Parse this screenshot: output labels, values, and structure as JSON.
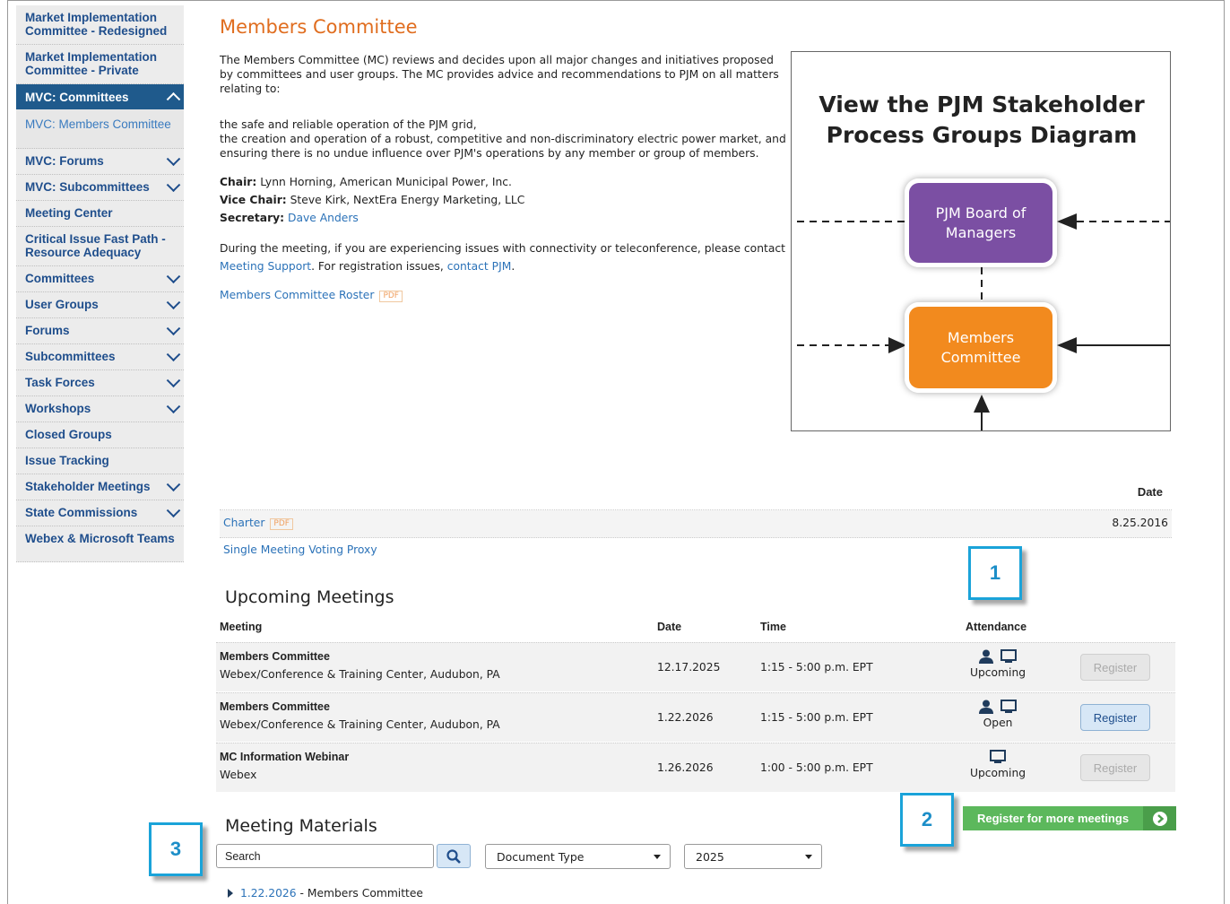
{
  "sidebar": {
    "items": [
      {
        "label": "Market Implementation Committee - Redesigned"
      },
      {
        "label": "Market Implementation Committee - Private"
      },
      {
        "label": "MVC: Committees"
      },
      {
        "label": "MVC: Members Committee"
      },
      {
        "label": "MVC: Forums"
      },
      {
        "label": "MVC: Subcommittees"
      },
      {
        "label": "Meeting Center"
      },
      {
        "label": "Critical Issue Fast Path - Resource Adequacy"
      },
      {
        "label": "Committees"
      },
      {
        "label": "User Groups"
      },
      {
        "label": "Forums"
      },
      {
        "label": "Subcommittees"
      },
      {
        "label": "Task Forces"
      },
      {
        "label": "Workshops"
      },
      {
        "label": "Closed Groups"
      },
      {
        "label": "Issue Tracking"
      },
      {
        "label": "Stakeholder Meetings"
      },
      {
        "label": "State Commissions"
      },
      {
        "label": "Webex & Microsoft Teams"
      }
    ]
  },
  "page": {
    "title": "Members Committee",
    "intro": "The Members Committee (MC) reviews and decides upon all major changes and initiatives proposed by committees and user groups. The MC provides advice and recommendations to PJM on all matters relating to:",
    "bullet1": "the safe and reliable operation of the PJM grid,",
    "bullet2": "the creation and operation of a robust, competitive and non-discriminatory electric power market, and",
    "bullet3": "ensuring there is no undue influence over PJM's operations by any member or group of members.",
    "chair_label": "Chair:",
    "chair_value": "Lynn Horning, American Municipal Power, Inc.",
    "vice_label": "Vice Chair:",
    "vice_value": "Steve Kirk, NextEra Energy Marketing, LLC",
    "secretary_label": "Secretary:",
    "secretary_value": "Dave Anders",
    "support_text1": "During the meeting, if you are experiencing issues with connectivity or teleconference, please contact",
    "support_link": "Meeting Support",
    "support_text2": ". For registration issues,",
    "contact_link": "contact PJM",
    "support_text3": ".",
    "roster_link": "Members Committee Roster",
    "pdf_badge": "PDF"
  },
  "diagram": {
    "title_line1": "View the PJM Stakeholder",
    "title_line2": "Process Groups Diagram",
    "box1": "PJM Board of Managers",
    "box2": "Members Committee",
    "box1_color": "#7b4fa3",
    "box2_color": "#f28a1e"
  },
  "documents": {
    "date_header": "Date",
    "rows": [
      {
        "name": "Charter",
        "badge": "PDF",
        "date": "8.25.2016"
      },
      {
        "name": "Single Meeting Voting Proxy",
        "date": ""
      }
    ]
  },
  "meetings": {
    "heading": "Upcoming Meetings",
    "headers": {
      "meeting": "Meeting",
      "date": "Date",
      "time": "Time",
      "attendance": "Attendance"
    },
    "rows": [
      {
        "name": "Members Committee",
        "location": "Webex/Conference & Training Center, Audubon, PA",
        "date": "12.17.2025",
        "time": "1:15 - 5:00 p.m. EPT",
        "status": "Upcoming",
        "button": "Register"
      },
      {
        "name": "Members Committee",
        "location": "Webex/Conference & Training Center, Audubon, PA",
        "date": "1.22.2026",
        "time": "1:15 - 5:00 p.m. EPT",
        "status": "Open",
        "button": "Register"
      },
      {
        "name": "MC Information Webinar",
        "location": "Webex",
        "date": "1.26.2026",
        "time": "1:00 - 5:00 p.m. EPT",
        "status": "Upcoming",
        "button": "Register"
      }
    ],
    "register_more": "Register for more meetings"
  },
  "materials": {
    "heading": "Meeting Materials",
    "search_value": "Search",
    "doc_type": "Document Type",
    "year": "2025",
    "entry_date": "1.22.2026",
    "entry_suffix": " - Members Committee"
  },
  "callouts": {
    "c1": "1",
    "c2": "2",
    "c3": "3"
  },
  "colors": {
    "accent_orange": "#e06d1f",
    "nav_blue": "#1f5a8c",
    "link_blue": "#2b72b8",
    "green": "#5cb85c",
    "callout": "#1aa3d9"
  }
}
